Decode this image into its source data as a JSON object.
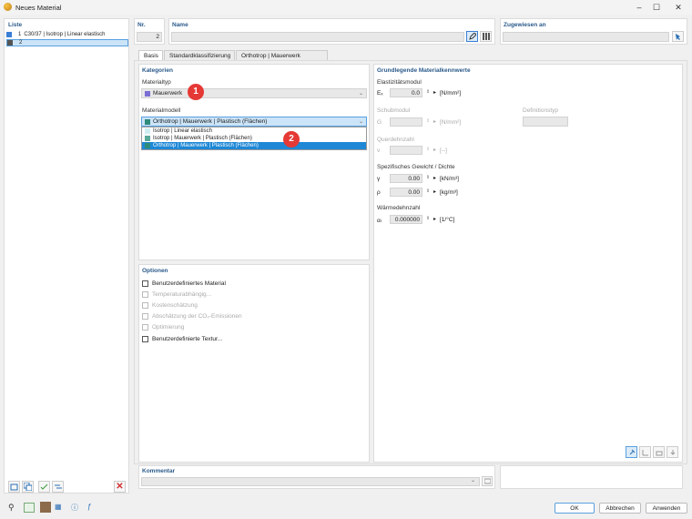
{
  "window": {
    "title": "Neues Material"
  },
  "list": {
    "header": "Liste",
    "items": [
      {
        "num": "1",
        "label": "C30/37 | Isotrop | Linear elastisch",
        "color": "#3a7fd5"
      },
      {
        "num": "2",
        "label": "",
        "color": "#555555"
      }
    ]
  },
  "nr": {
    "header": "Nr.",
    "value": "2"
  },
  "name": {
    "header": "Name",
    "value": ""
  },
  "assigned": {
    "header": "Zugewiesen an",
    "value": ""
  },
  "tabs": [
    "Basis",
    "Standardklassifizierung",
    "Orthotrop | Mauerwerk (Flächen)"
  ],
  "categories": {
    "header": "Kategorien",
    "material_type_label": "Materialtyp",
    "material_type_value": "Mauerwerk",
    "material_type_color": "#7b6fd6",
    "model_label": "Materialmodell",
    "model_value": "Orthotrop | Mauerwerk | Plastisch (Flächen)",
    "model_options": [
      {
        "label": "Isotrop | Linear elastisch",
        "color": "#cfeef2"
      },
      {
        "label": "Isotrop | Mauerwerk | Plastisch (Flächen)",
        "color": "#5aa89a"
      },
      {
        "label": "Orthotrop | Mauerwerk | Plastisch (Flächen)",
        "color": "#2e8b7a"
      }
    ]
  },
  "badges": [
    "1",
    "2"
  ],
  "options": {
    "header": "Optionen",
    "items": [
      {
        "label": "Benutzerdefiniertes Material",
        "enabled": true
      },
      {
        "label": "Temperaturabhängig...",
        "enabled": false
      },
      {
        "label": "Kostenschätzung",
        "enabled": false
      },
      {
        "label": "Abschätzung der CO₂-Emissionen",
        "enabled": false
      },
      {
        "label": "Optimierung",
        "enabled": false
      },
      {
        "label": "Benutzerdefinierte Textur...",
        "enabled": true
      }
    ]
  },
  "props": {
    "header": "Grundlegende Materialkennwerte",
    "elastic": {
      "label": "Elastizitätsmodul",
      "sym": "Eₓ",
      "value": "0.0",
      "unit": "[N/mm²]"
    },
    "shear": {
      "label": "Schubmodul",
      "sym": "G",
      "unit": "[N/mm²]"
    },
    "deftype": {
      "label": "Definitionstyp"
    },
    "poisson": {
      "label": "Querdehnzahl",
      "sym": "ν",
      "unit": "[--]"
    },
    "weight": {
      "label": "Spezifisches Gewicht / Dichte",
      "gamma": {
        "sym": "γ",
        "value": "0.00",
        "unit": "[kN/m³]"
      },
      "rho": {
        "sym": "ρ",
        "value": "0.00",
        "unit": "[kg/m³]"
      }
    },
    "thermal": {
      "label": "Wärmedehnzahl",
      "sym": "αₜ",
      "value": "0.000000",
      "unit": "[1/°C]"
    }
  },
  "comment": {
    "header": "Kommentar",
    "value": ""
  },
  "buttons": {
    "ok": "OK",
    "cancel": "Abbrechen",
    "apply": "Anwenden"
  }
}
